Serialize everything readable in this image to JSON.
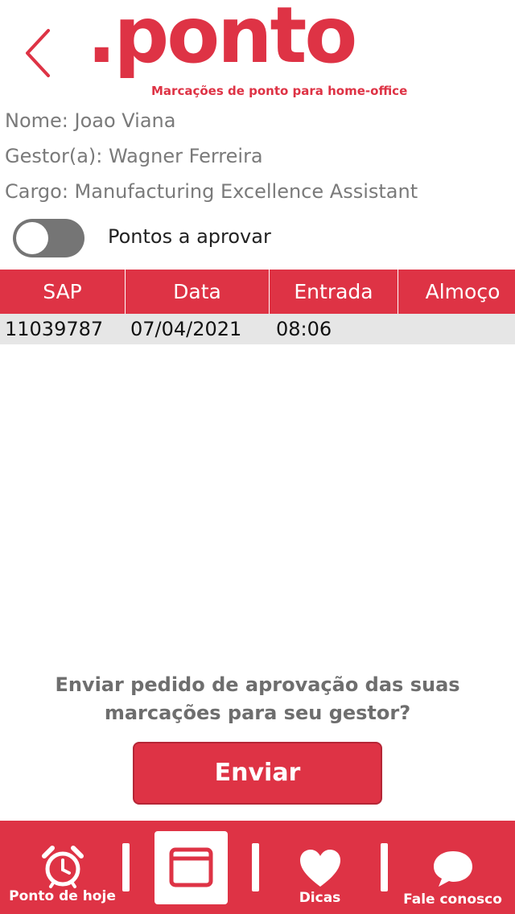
{
  "header": {
    "back_icon": "chevron-left-icon",
    "logo_word": ".ponto",
    "logo_tagline": "Marcações de ponto para home-office"
  },
  "profile": {
    "name": "Nome: Joao Viana",
    "manager": "Gestor(a): Wagner Ferreira",
    "role": "Cargo: Manufacturing Excellence Assistant"
  },
  "filter": {
    "toggle_on": false,
    "toggle_label": "Pontos a aprovar"
  },
  "table": {
    "columns": [
      "SAP",
      "Data",
      "Entrada",
      "Almoço"
    ],
    "rows": [
      {
        "sap": "11039787",
        "data": "07/04/2021",
        "entrada": "08:06"
      }
    ]
  },
  "approval": {
    "prompt_line1": "Enviar pedido de aprovação das suas",
    "prompt_line2": "marcações para seu gestor?",
    "send_label": "Enviar"
  },
  "nav": {
    "items": [
      {
        "label": "Ponto de hoje",
        "icon": "alarm-clock-icon"
      },
      {
        "label": "",
        "icon": "window-icon",
        "active": true
      },
      {
        "label": "Dicas",
        "icon": "heart-icon"
      },
      {
        "label": "Fale conosco",
        "icon": "chat-bubble-icon"
      }
    ]
  },
  "colors": {
    "accent": "#de3345",
    "toggle_off": "#757575",
    "row_bg": "#e6e6e6",
    "muted_text": "#7a7a7a"
  }
}
